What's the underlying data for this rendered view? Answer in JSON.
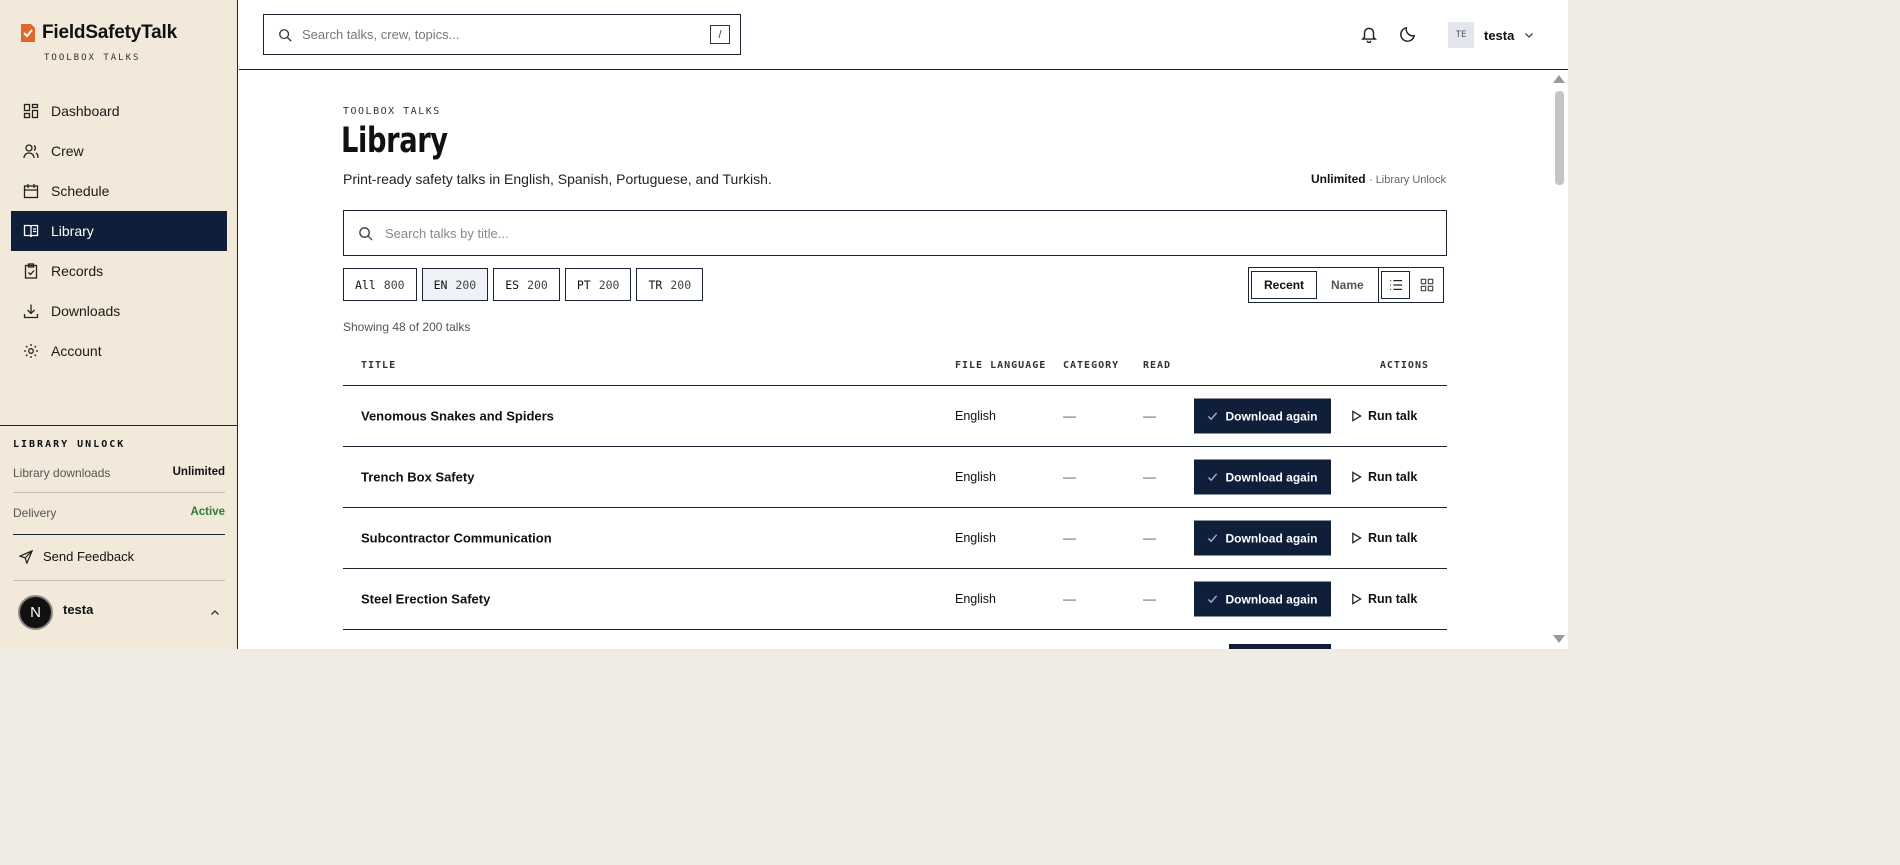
{
  "brand": {
    "name": "FieldSafetyTalk",
    "tagline": "TOOLBOX TALKS"
  },
  "sidebar": {
    "items": [
      {
        "label": "Dashboard",
        "icon": "dashboard-icon"
      },
      {
        "label": "Crew",
        "icon": "users-icon"
      },
      {
        "label": "Schedule",
        "icon": "calendar-icon"
      },
      {
        "label": "Library",
        "icon": "book-icon",
        "active": true
      },
      {
        "label": "Records",
        "icon": "clipboard-icon"
      },
      {
        "label": "Downloads",
        "icon": "download-icon"
      },
      {
        "label": "Account",
        "icon": "gear-icon"
      }
    ],
    "library_unlock": {
      "title": "LIBRARY UNLOCK",
      "downloads_label": "Library downloads",
      "downloads_value": "Unlimited",
      "delivery_label": "Delivery",
      "delivery_value": "Active"
    },
    "feedback_label": "Send Feedback",
    "user": {
      "initial": "N",
      "name": "testa"
    }
  },
  "topbar": {
    "search_placeholder": "Search talks, crew, topics...",
    "shortcut": "/",
    "user_initials": "TE",
    "user_name": "testa"
  },
  "main": {
    "eyebrow": "TOOLBOX TALKS",
    "title": "Library",
    "subtitle": "Print-ready safety talks in English, Spanish, Portuguese, and Turkish.",
    "plan_strong": "Unlimited",
    "plan_note": "· Library Unlock",
    "search_placeholder": "Search talks by title...",
    "filters": [
      {
        "code": "All",
        "count": "800"
      },
      {
        "code": "EN",
        "count": "200",
        "active": true
      },
      {
        "code": "ES",
        "count": "200"
      },
      {
        "code": "PT",
        "count": "200"
      },
      {
        "code": "TR",
        "count": "200"
      }
    ],
    "sort": {
      "recent": "Recent",
      "name": "Name"
    },
    "showing": "Showing 48 of 200 talks",
    "columns": {
      "title": "TITLE",
      "file_language": "FILE LANGUAGE",
      "category": "CATEGORY",
      "read": "READ",
      "actions": "ACTIONS"
    },
    "rows": [
      {
        "title": "Venomous Snakes and Spiders",
        "language": "English",
        "category": "—",
        "read": "—",
        "download": "Download again",
        "run": "Run talk"
      },
      {
        "title": "Trench Box Safety",
        "language": "English",
        "category": "—",
        "read": "—",
        "download": "Download again",
        "run": "Run talk"
      },
      {
        "title": "Subcontractor Communication",
        "language": "English",
        "category": "—",
        "read": "—",
        "download": "Download again",
        "run": "Run talk"
      },
      {
        "title": "Steel Erection Safety",
        "language": "English",
        "category": "—",
        "read": "—",
        "download": "Download again",
        "run": "Run talk"
      }
    ]
  },
  "colors": {
    "navy": "#0f1f3a",
    "sidebar_bg": "#f2e9da",
    "brand_orange": "#e0672a",
    "active_green": "#2d7a3a"
  }
}
